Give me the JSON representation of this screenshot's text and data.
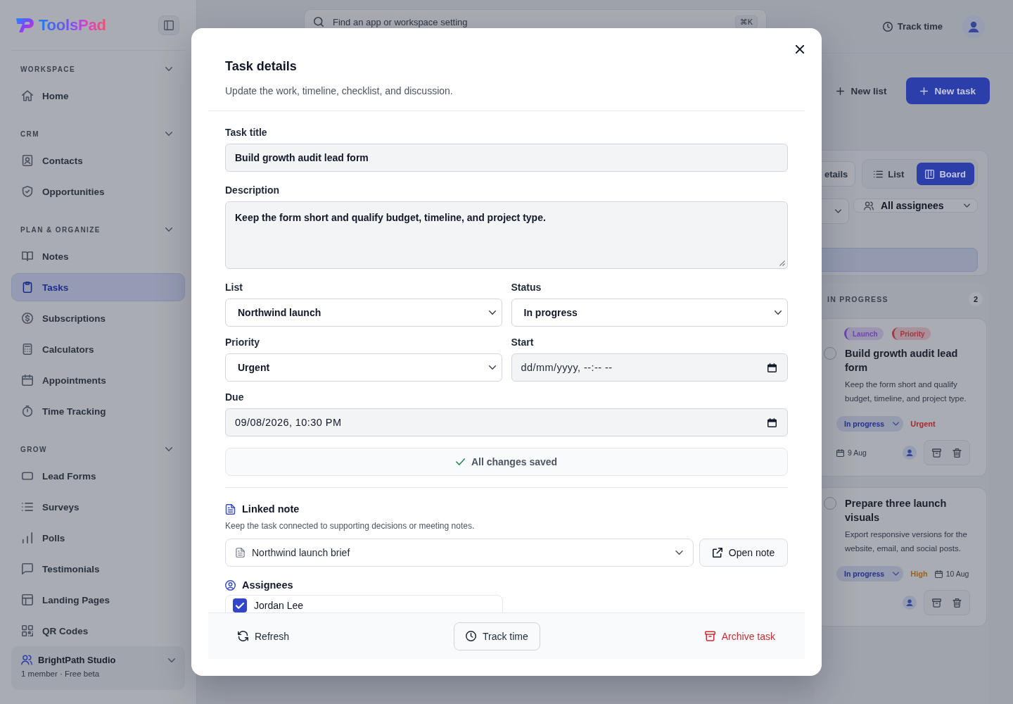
{
  "sidebar": {
    "logo": "ToolsPad",
    "sections": [
      {
        "title": "WORKSPACE",
        "expanded": true,
        "items": [
          {
            "label": "Home",
            "selected": false
          }
        ]
      },
      {
        "title": "CRM",
        "expanded": true,
        "items": [
          {
            "label": "Contacts",
            "selected": false
          },
          {
            "label": "Opportunities",
            "selected": false
          }
        ]
      },
      {
        "title": "PLAN & ORGANIZE",
        "expanded": true,
        "items": [
          {
            "label": "Notes",
            "selected": false
          },
          {
            "label": "Tasks",
            "selected": true
          },
          {
            "label": "Subscriptions",
            "selected": false
          },
          {
            "label": "Calculators",
            "selected": false
          },
          {
            "label": "Appointments",
            "selected": false
          },
          {
            "label": "Time Tracking",
            "selected": false
          }
        ]
      },
      {
        "title": "GROW",
        "expanded": true,
        "items": [
          {
            "label": "Lead Forms",
            "selected": false
          },
          {
            "label": "Surveys",
            "selected": false
          },
          {
            "label": "Polls",
            "selected": false
          },
          {
            "label": "Testimonials",
            "selected": false
          },
          {
            "label": "Landing Pages",
            "selected": false
          },
          {
            "label": "QR Codes",
            "selected": false
          }
        ]
      }
    ],
    "workspace": {
      "name": "BrightPath Studio",
      "meta": "1 member · Free beta"
    }
  },
  "topbar": {
    "search": {
      "placeholder": "Find an app or workspace setting",
      "shortcut": "⌘K"
    },
    "track_time": "Track time"
  },
  "page_actions": [
    {
      "kind": "secondary",
      "label": "New list"
    },
    {
      "kind": "primary",
      "label": "New task"
    }
  ],
  "board": {
    "views": [
      {
        "kind": "details",
        "label": "etails",
        "selected": false
      },
      {
        "kind": "list",
        "label": "List",
        "selected": false
      },
      {
        "kind": "board",
        "label": "Board",
        "selected": true
      }
    ],
    "assignee_filter": "All assignees",
    "columns": [
      {
        "title": "IN PROGRESS",
        "count": "2",
        "cards": [
          {
            "tags": [
              {
                "label": "Launch",
                "color": "#6c44b0"
              },
              {
                "label": "Priority",
                "color": "#a8323f"
              }
            ],
            "done": false,
            "title": "Build growth audit lead form",
            "description": "Keep the form short and qualify budget, timeline, and project type.",
            "status": "In progress",
            "priority": {
              "label": "Urgent",
              "color": "#a82830"
            },
            "due": "9 Aug"
          },
          {
            "done": false,
            "title": "Prepare three launch visuals",
            "description": "Export responsive versions for the website, email, and social posts.",
            "status": "In progress",
            "priority": {
              "label": "High",
              "color": "#9a6414"
            },
            "due": "10 Aug"
          }
        ]
      }
    ]
  },
  "modal": {
    "title": "Task details",
    "subtitle": "Update the work, timeline, checklist, and discussion.",
    "task_title": {
      "label": "Task title",
      "value": "Build growth audit lead form"
    },
    "description": {
      "label": "Description",
      "value": "Keep the form short and qualify budget, timeline, and project type."
    },
    "fields": [
      {
        "kind": "select",
        "label": "List",
        "value": "Northwind launch"
      },
      {
        "kind": "select",
        "label": "Status",
        "value": "In progress"
      },
      {
        "kind": "select",
        "label": "Priority",
        "value": "Urgent"
      },
      {
        "kind": "datetime",
        "label": "Start",
        "placeholder": "dd/mm/yyyy, --:-- --"
      },
      {
        "kind": "datetime",
        "label": "Due",
        "value": "09/08/2026, 10:30 PM"
      }
    ],
    "save_status": "All changes saved",
    "linked_note": {
      "title": "Linked note",
      "description": "Keep the task connected to supporting decisions or meeting notes.",
      "note": "Northwind launch brief",
      "open_button": "Open note"
    },
    "assignees": {
      "title": "Assignees",
      "people": [
        {
          "name": "Jordan Lee",
          "checked": true
        }
      ]
    },
    "footer_buttons": [
      {
        "kind": "refresh",
        "label": "Refresh"
      },
      {
        "kind": "track",
        "label": "Track time"
      },
      {
        "kind": "archive",
        "label": "Archive task"
      }
    ]
  }
}
